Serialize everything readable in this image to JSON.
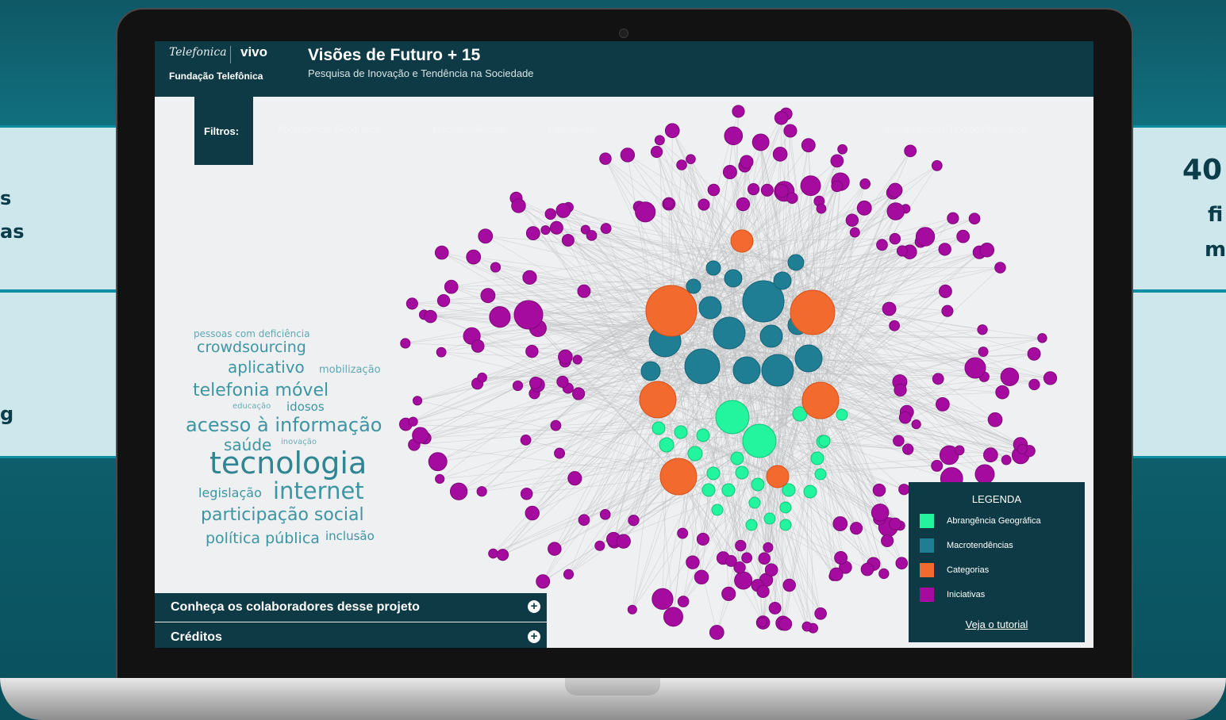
{
  "side_left": {
    "lines": [
      "s",
      "as",
      "g"
    ]
  },
  "side_right": {
    "number": "40",
    "line1": "fi",
    "line2": "m"
  },
  "header": {
    "logo_telefonica": "Telefonica",
    "logo_vivo": "vivo",
    "logo_fundacao": "Fundação Telefônica",
    "title": "Visões de Futuro + 15",
    "subtitle": "Pesquisa de Inovação e Tendência na Sociedade"
  },
  "filters": {
    "label": "Filtros:",
    "items": [
      "Abrangência Geográfica",
      "Macrotendências",
      "Categorias",
      "Ano de Início / Tipo de Projeto >>"
    ]
  },
  "word_cloud": [
    {
      "text": "pessoas com deficiência"
    },
    {
      "text": "crowdsourcing"
    },
    {
      "text": "aplicativo"
    },
    {
      "text": "mobilização"
    },
    {
      "text": "telefonia móvel"
    },
    {
      "text": "educação"
    },
    {
      "text": "idosos"
    },
    {
      "text": "acesso à informação"
    },
    {
      "text": "saúde"
    },
    {
      "text": "inovação"
    },
    {
      "text": "tecnologia"
    },
    {
      "text": "legislação"
    },
    {
      "text": "internet"
    },
    {
      "text": "participação social"
    },
    {
      "text": "política pública"
    },
    {
      "text": "inclusão"
    }
  ],
  "accordion": {
    "collaborators": "Conheça os colaboradores desse projeto",
    "credits": "Créditos",
    "plus_symbol": "+"
  },
  "legend": {
    "title": "LEGENDA",
    "items": [
      {
        "label": "Abrangência Geográfica",
        "color": "#22f59e"
      },
      {
        "label": "Macrotendências",
        "color": "#1f7e94"
      },
      {
        "label": "Categorias",
        "color": "#f26a2e"
      },
      {
        "label": "Iniciativas",
        "color": "#a60ba0"
      }
    ],
    "tutorial": "Veja o tutorial"
  },
  "colors": {
    "header_bg": "#0e3a46",
    "edge": "#b9bcbd",
    "initiative": "#a60ba0",
    "macro": "#1f7e94",
    "category": "#f26a2e",
    "geo": "#22f59e"
  }
}
